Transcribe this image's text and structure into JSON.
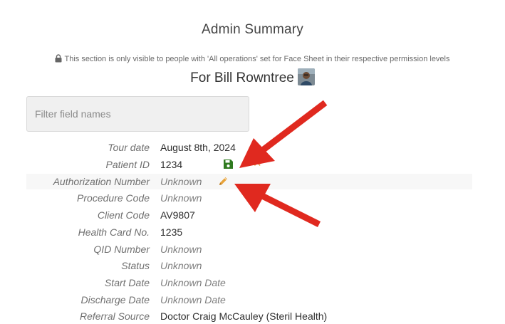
{
  "header": {
    "title": "Admin Summary",
    "visibility_note": "This section is only visible to people with 'All operations' set for Face Sheet in their respective permission levels",
    "subtitle": "For Bill Rowntree"
  },
  "filter": {
    "placeholder": "Filter field names",
    "value": ""
  },
  "fields": [
    {
      "label": "Tour date",
      "value": "August 8th, 2024",
      "unknown": false
    },
    {
      "label": "Patient ID",
      "value": "1234",
      "unknown": false,
      "editing": true
    },
    {
      "label": "Authorization Number",
      "value": "Unknown",
      "unknown": true,
      "hovered": true
    },
    {
      "label": "Procedure Code",
      "value": "Unknown",
      "unknown": true
    },
    {
      "label": "Client Code",
      "value": "AV9807",
      "unknown": false
    },
    {
      "label": "Health Card No.",
      "value": "1235",
      "unknown": false
    },
    {
      "label": "QID Number",
      "value": "Unknown",
      "unknown": true
    },
    {
      "label": "Status",
      "value": "Unknown",
      "unknown": true
    },
    {
      "label": "Start Date",
      "value": "Unknown Date",
      "unknown": true
    },
    {
      "label": "Discharge Date",
      "value": "Unknown Date",
      "unknown": true
    },
    {
      "label": "Referral Source",
      "value": "Doctor Craig McCauley (Steril Health)",
      "unknown": false
    }
  ],
  "colors": {
    "save_icon": "#2f7a1f",
    "cancel_icon": "#e39b3e",
    "edit_icon": "#e8a33a",
    "annotation_arrow": "#e0291f"
  },
  "icons": {
    "lock": "lock-icon",
    "save": "floppy-disk-icon",
    "cancel": "close-icon",
    "edit": "pencil-icon",
    "avatar": "user-photo"
  }
}
